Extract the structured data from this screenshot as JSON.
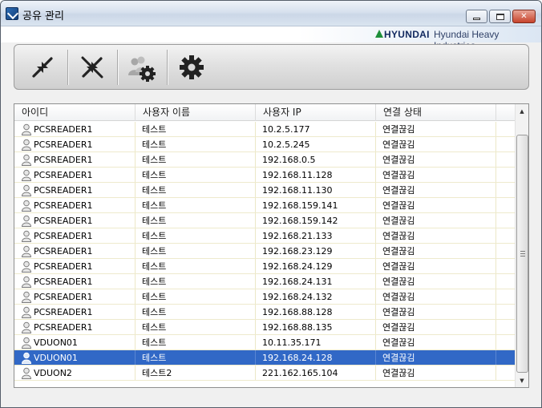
{
  "window": {
    "title": "공유 관리",
    "brand_name": "HYUNDAI",
    "brand_sub": "Hyundai Heavy Industries"
  },
  "toolbar": {
    "buttons": [
      {
        "icon": "collapse-arrows-icon"
      },
      {
        "icon": "disconnect-icon"
      },
      {
        "icon": "users-settings-icon"
      },
      {
        "icon": "gear-icon"
      }
    ]
  },
  "table": {
    "columns": [
      "아이디",
      "사용자 이름",
      "사용자 IP",
      "연결 상태"
    ],
    "rows": [
      {
        "id": "PCSREADER1",
        "name": "테스트",
        "ip": "10.2.5.177",
        "status": "연결끊김"
      },
      {
        "id": "PCSREADER1",
        "name": "테스트",
        "ip": "10.2.5.245",
        "status": "연결끊김"
      },
      {
        "id": "PCSREADER1",
        "name": "테스트",
        "ip": "192.168.0.5",
        "status": "연결끊김"
      },
      {
        "id": "PCSREADER1",
        "name": "테스트",
        "ip": "192.168.11.128",
        "status": "연결끊김"
      },
      {
        "id": "PCSREADER1",
        "name": "테스트",
        "ip": "192.168.11.130",
        "status": "연결끊김"
      },
      {
        "id": "PCSREADER1",
        "name": "테스트",
        "ip": "192.168.159.141",
        "status": "연결끊김"
      },
      {
        "id": "PCSREADER1",
        "name": "테스트",
        "ip": "192.168.159.142",
        "status": "연결끊김"
      },
      {
        "id": "PCSREADER1",
        "name": "테스트",
        "ip": "192.168.21.133",
        "status": "연결끊김"
      },
      {
        "id": "PCSREADER1",
        "name": "테스트",
        "ip": "192.168.23.129",
        "status": "연결끊김"
      },
      {
        "id": "PCSREADER1",
        "name": "테스트",
        "ip": "192.168.24.129",
        "status": "연결끊김"
      },
      {
        "id": "PCSREADER1",
        "name": "테스트",
        "ip": "192.168.24.131",
        "status": "연결끊김"
      },
      {
        "id": "PCSREADER1",
        "name": "테스트",
        "ip": "192.168.24.132",
        "status": "연결끊김"
      },
      {
        "id": "PCSREADER1",
        "name": "테스트",
        "ip": "192.168.88.128",
        "status": "연결끊김"
      },
      {
        "id": "PCSREADER1",
        "name": "테스트",
        "ip": "192.168.88.135",
        "status": "연결끊김"
      },
      {
        "id": "VDUON01",
        "name": "테스트",
        "ip": "10.11.35.171",
        "status": "연결끊김"
      },
      {
        "id": "VDUON01",
        "name": "테스트",
        "ip": "192.168.24.128",
        "status": "연결끊김",
        "selected": true
      },
      {
        "id": "VDUON2",
        "name": "테스트2",
        "ip": "221.162.165.104",
        "status": "연결끊김"
      }
    ]
  },
  "colors": {
    "selection": "#3168c6",
    "brand_green": "#1f8f3a",
    "brand_navy": "#12295f"
  }
}
